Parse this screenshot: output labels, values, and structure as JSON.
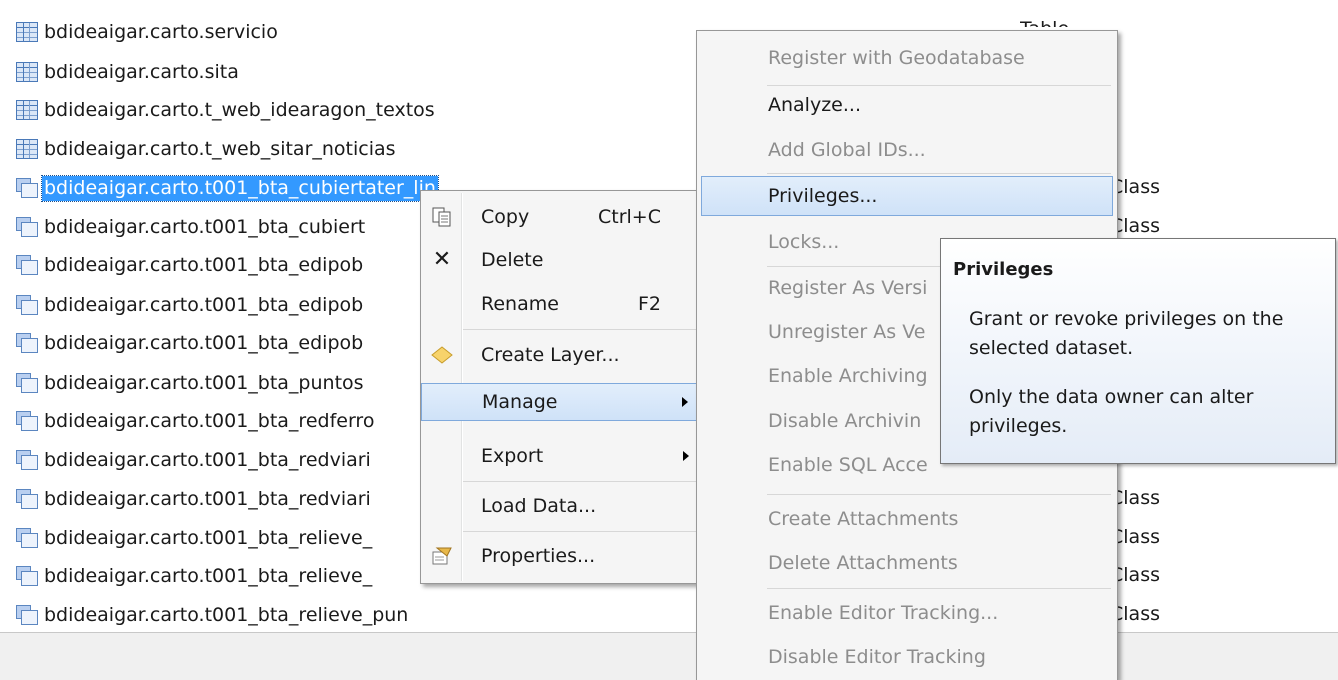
{
  "catalog": {
    "rows": [
      {
        "name": "bdideaigar.carto.servicio",
        "icon": "table-icon",
        "type": "Table"
      },
      {
        "name": "bdideaigar.carto.sita",
        "icon": "table-icon",
        "type": ""
      },
      {
        "name": "bdideaigar.carto.t_web_idearagon_textos",
        "icon": "table-icon",
        "type": ""
      },
      {
        "name": "bdideaigar.carto.t_web_sitar_noticias",
        "icon": "table-icon",
        "type": ""
      },
      {
        "name": "bdideaigar.carto.t001_bta_cubiertater_lin",
        "icon": "feature-class-icon",
        "type": "Class",
        "selected": true
      },
      {
        "name": "bdideaigar.carto.t001_bta_cubiert",
        "icon": "feature-class-icon",
        "type": "Class"
      },
      {
        "name": "bdideaigar.carto.t001_bta_edipob",
        "icon": "feature-class-icon",
        "type": ""
      },
      {
        "name": "bdideaigar.carto.t001_bta_edipob",
        "icon": "feature-class-icon",
        "type": ""
      },
      {
        "name": "bdideaigar.carto.t001_bta_edipob",
        "icon": "feature-class-icon",
        "type": ""
      },
      {
        "name": "bdideaigar.carto.t001_bta_puntos",
        "icon": "feature-class-icon",
        "type": ""
      },
      {
        "name": "bdideaigar.carto.t001_bta_redferro",
        "icon": "feature-class-icon",
        "type": ""
      },
      {
        "name": "bdideaigar.carto.t001_bta_redviari",
        "icon": "feature-class-icon",
        "type": ""
      },
      {
        "name": "bdideaigar.carto.t001_bta_redviari",
        "icon": "feature-class-icon",
        "type": "Class"
      },
      {
        "name": "bdideaigar.carto.t001_bta_relieve_",
        "icon": "feature-class-icon",
        "type": "Class"
      },
      {
        "name": "bdideaigar.carto.t001_bta_relieve_",
        "icon": "feature-class-icon",
        "type": "Class"
      },
      {
        "name": "bdideaigar.carto.t001_bta_relieve_pun",
        "icon": "feature-class-icon",
        "type": "Class"
      }
    ]
  },
  "context_menu": {
    "items": [
      {
        "label": "Copy",
        "shortcut": "Ctrl+C",
        "icon": "copy-icon"
      },
      {
        "label": "Delete",
        "shortcut": "",
        "icon": "delete-icon"
      },
      {
        "label": "Rename",
        "shortcut": "F2",
        "icon": ""
      },
      {
        "label": "Create Layer...",
        "shortcut": "",
        "icon": "layer-icon"
      },
      {
        "label": "Manage",
        "shortcut": "",
        "icon": "",
        "submenu": true,
        "highlighted": true
      },
      {
        "label": "Export",
        "shortcut": "",
        "icon": "",
        "submenu": true
      },
      {
        "label": "Load Data...",
        "shortcut": "",
        "icon": ""
      },
      {
        "label": "Properties...",
        "shortcut": "",
        "icon": "properties-icon"
      }
    ]
  },
  "manage_menu": {
    "items": [
      {
        "label": "Register with Geodatabase",
        "enabled": false
      },
      {
        "label": "Analyze...",
        "enabled": true
      },
      {
        "label": "Add Global IDs...",
        "enabled": false
      },
      {
        "label": "Privileges...",
        "enabled": true,
        "highlighted": true
      },
      {
        "label": "Locks...",
        "enabled": false
      },
      {
        "label": "Register As Versi",
        "enabled": false
      },
      {
        "label": "Unregister As Ve",
        "enabled": false
      },
      {
        "label": "Enable Archiving",
        "enabled": false
      },
      {
        "label": "Disable Archivin",
        "enabled": false
      },
      {
        "label": "Enable SQL Acce",
        "enabled": false
      },
      {
        "label": "Create Attachments",
        "enabled": false
      },
      {
        "label": "Delete Attachments",
        "enabled": false
      },
      {
        "label": "Enable Editor Tracking...",
        "enabled": false
      },
      {
        "label": "Disable Editor Tracking",
        "enabled": false
      }
    ]
  },
  "tooltip": {
    "title": "Privileges",
    "line1": "Grant or revoke privileges on the selected dataset.",
    "line2": "Only the data owner can alter privileges."
  },
  "colors": {
    "selection": "#3399ff",
    "highlight": "#cfe2f8",
    "disabled_text": "#8d8d8d"
  }
}
